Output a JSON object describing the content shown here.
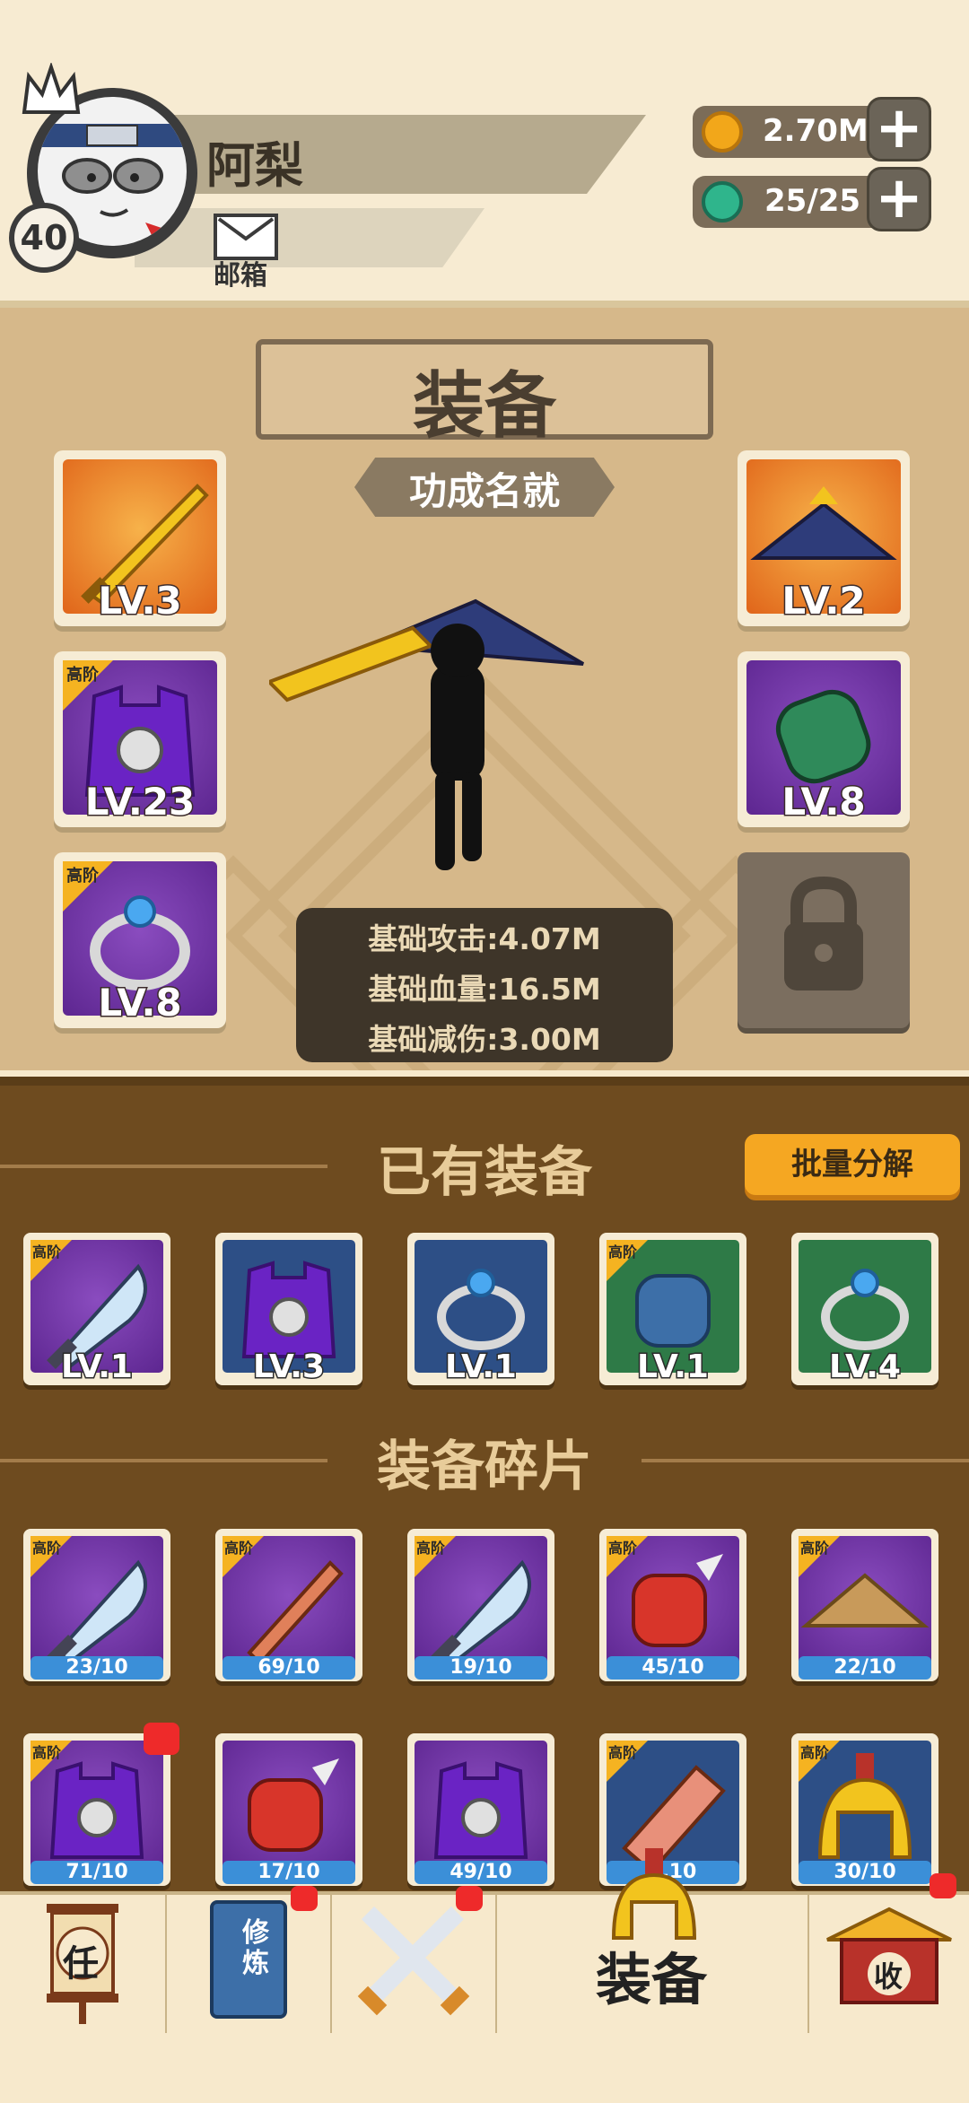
{
  "player": {
    "name": "阿梨",
    "level": "40",
    "mail_label": "邮箱"
  },
  "resources": {
    "coins": "2.70M",
    "gems": "25/25",
    "coin_color": "#f2a71a",
    "gem_color": "#2fb58c"
  },
  "equip_panel": {
    "title": "装备",
    "subtitle": "功成名就",
    "high_tier_label": "高阶",
    "left_slots": [
      {
        "icon": "golden-sword-icon",
        "level": "LV.3",
        "high_tier": false,
        "bg": "orange"
      },
      {
        "icon": "armor-vest-icon",
        "level": "LV.23",
        "high_tier": true,
        "bg": "purple"
      },
      {
        "icon": "ring-icon",
        "level": "LV.8",
        "high_tier": true,
        "bg": "purple"
      }
    ],
    "right_slots": [
      {
        "icon": "straw-hat-icon",
        "level": "LV.2",
        "high_tier": false,
        "bg": "orange"
      },
      {
        "icon": "bracer-icon",
        "level": "LV.8",
        "high_tier": false,
        "bg": "purple"
      }
    ],
    "locked_slot_icon": "lock-icon",
    "stats": [
      "基础攻击:4.07M",
      "基础血量:16.5M",
      "基础减伤:3.00M"
    ]
  },
  "inventory": {
    "owned_title": "已有装备",
    "batch_button": "批量分解",
    "owned_items": [
      {
        "icon": "blade-icon",
        "level": "LV.1",
        "high_tier": true,
        "bg": "purple"
      },
      {
        "icon": "armor-vest-icon",
        "level": "LV.3",
        "high_tier": false,
        "bg": "blue"
      },
      {
        "icon": "ring-icon",
        "level": "LV.1",
        "high_tier": false,
        "bg": "blue"
      },
      {
        "icon": "gauntlet-icon",
        "level": "LV.1",
        "high_tier": true,
        "bg": "green"
      },
      {
        "icon": "ring-icon",
        "level": "LV.4",
        "high_tier": false,
        "bg": "green"
      }
    ],
    "fragments_title": "装备碎片",
    "fragments": [
      {
        "icon": "blade-icon",
        "count": "23/10",
        "high_tier": true,
        "bg": "purple",
        "badge": false
      },
      {
        "icon": "wooden-sword-icon",
        "count": "69/10",
        "high_tier": true,
        "bg": "purple",
        "badge": false
      },
      {
        "icon": "blade-icon",
        "count": "19/10",
        "high_tier": true,
        "bg": "purple",
        "badge": false
      },
      {
        "icon": "spiked-gauntlet-icon",
        "count": "45/10",
        "high_tier": true,
        "bg": "purple",
        "badge": false
      },
      {
        "icon": "straw-hat-icon",
        "count": "22/10",
        "high_tier": true,
        "bg": "purple",
        "badge": false
      },
      {
        "icon": "armor-vest-icon",
        "count": "71/10",
        "high_tier": true,
        "bg": "purple",
        "badge": true
      },
      {
        "icon": "spiked-gauntlet-icon",
        "count": "17/10",
        "high_tier": false,
        "bg": "purple",
        "badge": false
      },
      {
        "icon": "armor-vest-icon",
        "count": "49/10",
        "high_tier": false,
        "bg": "purple",
        "badge": false
      },
      {
        "icon": "cleaver-icon",
        "count": "…10",
        "high_tier": true,
        "bg": "blue",
        "badge": false
      },
      {
        "icon": "helmet-icon",
        "count": "30/10",
        "high_tier": true,
        "bg": "blue",
        "badge": false
      }
    ]
  },
  "bottom_nav": {
    "tasks_icon": "任",
    "cultivate_icon": "修炼",
    "battle_icon": "crossed-swords-icon",
    "equip_label": "装备",
    "collect_icon": "收"
  }
}
